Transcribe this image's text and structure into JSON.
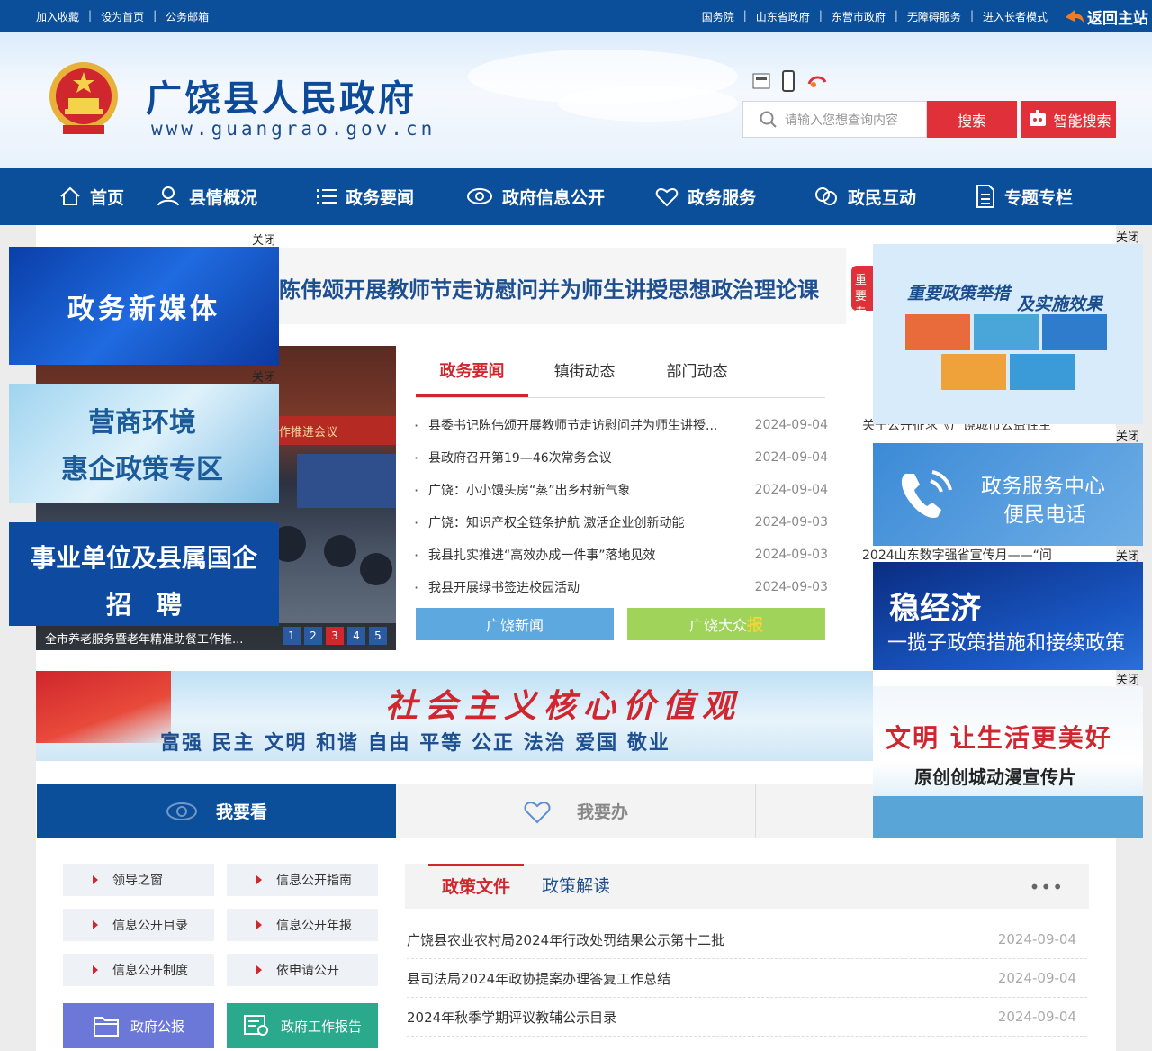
{
  "topbar": {
    "left_links": [
      "加入收藏",
      "设为首页",
      "公务邮箱"
    ],
    "right_links": [
      "国务院",
      "山东省政府",
      "东营市政府",
      "无障碍服务",
      "进入长者模式"
    ],
    "back_label": "返回主站"
  },
  "header": {
    "title": "广饶县人民政府",
    "url": "www.guangrao.gov.cn",
    "search_placeholder": "请输入您想查询内容",
    "search_button": "搜索",
    "smart_search_button": "智能搜索"
  },
  "nav": {
    "items": [
      {
        "label": "首页",
        "icon": "home-icon"
      },
      {
        "label": "县情概况",
        "icon": "person-icon"
      },
      {
        "label": "政务要闻",
        "icon": "list-icon"
      },
      {
        "label": "政府信息公开",
        "icon": "eye-icon"
      },
      {
        "label": "政务服务",
        "icon": "heart-icon"
      },
      {
        "label": "政民互动",
        "icon": "chat-icon"
      },
      {
        "label": "专题专栏",
        "icon": "document-icon"
      }
    ]
  },
  "headline": {
    "text": "陈伟颂开展教师节走访慰问并为师生讲授思想政治理论课",
    "side_tag": "重要专"
  },
  "slider": {
    "banner_text": "作推进会议",
    "caption": "全市养老服务暨老年精准助餐工作推...",
    "pages": [
      "1",
      "2",
      "3",
      "4",
      "5"
    ],
    "active_page": "3"
  },
  "news": {
    "tabs": [
      "政务要闻",
      "镇街动态",
      "部门动态"
    ],
    "active_tab": "政务要闻",
    "items": [
      {
        "title": "县委书记陈伟颂开展教师节走访慰问并为师生讲授...",
        "date": "2024-09-04"
      },
      {
        "title": "县政府召开第19—46次常务会议",
        "date": "2024-09-04"
      },
      {
        "title": "广饶：小小馒头房“蒸”出乡村新气象",
        "date": "2024-09-04"
      },
      {
        "title": "广饶：知识产权全链条护航 激活企业创新动能",
        "date": "2024-09-03"
      },
      {
        "title": "我县扎实推进“高效办成一件事”落地见效",
        "date": "2024-09-03"
      },
      {
        "title": "我县开展绿书签进校园活动",
        "date": "2024-09-03"
      }
    ],
    "button_news": "广饶新闻",
    "button_paper_prefix": "广饶大众",
    "button_paper_suffix": "报"
  },
  "right_column": {
    "fragment_1": "关于公开征求《广饶城市公益性主",
    "fragment_2": "2024山东数字强省宣传月——“问"
  },
  "values_banner": {
    "title": "社会主义核心价值观",
    "words": "富强  民主  文明  和谐    自由  平等  公正  法治    爱国  敬业"
  },
  "lower_tabs": {
    "look": "我要看",
    "do": "我要办"
  },
  "quick_links": [
    "领导之窗",
    "信息公开指南",
    "信息公开目录",
    "信息公开年报",
    "信息公开制度",
    "依申请公开"
  ],
  "big_buttons": {
    "bulletin": "政府公报",
    "report": "政府工作报告",
    "bulletin_color": "#6b78d8",
    "report_color": "#2aa98c"
  },
  "policy": {
    "tabs": [
      "政策文件",
      "政策解读"
    ],
    "active_tab": "政策文件",
    "more": "•••",
    "items": [
      {
        "title": "广饶县农业农村局2024年行政处罚结果公示第十二批",
        "date": "2024-09-04"
      },
      {
        "title": "县司法局2024年政协提案办理答复工作总结",
        "date": "2024-09-04"
      },
      {
        "title": "2024年秋季学期评议教辅公示目录",
        "date": "2024-09-04"
      }
    ]
  },
  "ads": {
    "close_label": "关闭",
    "media": "政务新媒体",
    "biz_line1": "营商环境",
    "biz_line2": "惠企政策专区",
    "recruit_line1": "事业单位及县属国企",
    "recruit_line2": "招聘",
    "policy_line1": "重要政策举措",
    "policy_line2": "及实施效果",
    "phone_line1": "政务服务中心",
    "phone_line2": "便民电话",
    "econ_line1": "稳经济",
    "econ_line2": "一揽子政策措施和接续政策",
    "civil_line1": "文明 让生活更美好",
    "civil_line2": "原创创城动漫宣传片"
  },
  "colors": {
    "brand_blue": "#0b4f9a",
    "accent_red": "#e0313a"
  }
}
